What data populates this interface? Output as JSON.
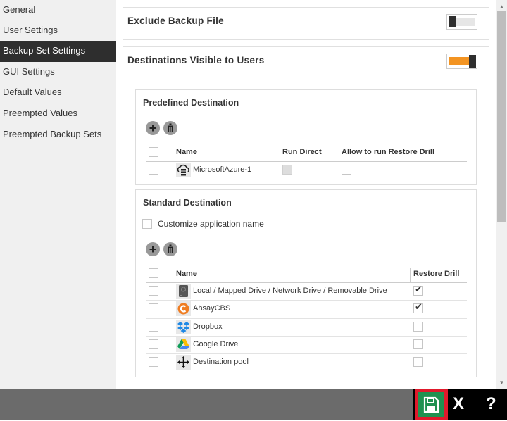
{
  "sidebar": {
    "items": [
      {
        "label": "General",
        "active": false
      },
      {
        "label": "User Settings",
        "active": false
      },
      {
        "label": "Backup Set Settings",
        "active": true
      },
      {
        "label": "GUI Settings",
        "active": false
      },
      {
        "label": "Default Values",
        "active": false
      },
      {
        "label": "Preempted Values",
        "active": false
      },
      {
        "label": "Preempted Backup Sets",
        "active": false
      }
    ]
  },
  "panels": {
    "exclude_backup_file": {
      "title": "Exclude Backup File",
      "toggle": "off"
    },
    "destinations_visible": {
      "title": "Destinations Visible to Users",
      "toggle": "on",
      "accent_color": "#f39422"
    }
  },
  "predefined": {
    "title": "Predefined Destination",
    "add_icon": "plus-icon",
    "delete_icon": "trash-icon",
    "columns": [
      "Name",
      "Run Direct",
      "Allow to run Restore Drill"
    ],
    "rows": [
      {
        "name": "MicrosoftAzure-1",
        "icon": "azure-cloud-icon",
        "selected": false,
        "run_direct": false,
        "run_direct_disabled": true,
        "restore_drill": false
      }
    ]
  },
  "standard": {
    "title": "Standard Destination",
    "customize_label": "Customize application name",
    "customize_checked": false,
    "columns": [
      "Name",
      "Restore Drill"
    ],
    "rows": [
      {
        "name": "Local / Mapped Drive / Network Drive / Removable Drive",
        "icon": "local-drive-icon",
        "restore_drill": true
      },
      {
        "name": "AhsayCBS",
        "icon": "ahsaycbs-icon",
        "restore_drill": true
      },
      {
        "name": "Dropbox",
        "icon": "dropbox-icon",
        "restore_drill": false
      },
      {
        "name": "Google Drive",
        "icon": "google-drive-icon",
        "restore_drill": false
      },
      {
        "name": "Destination pool",
        "icon": "destination-pool-icon",
        "restore_drill": false
      }
    ],
    "check_glyph": "✔"
  },
  "footer": {
    "save_icon": "save-icon",
    "close_label": "X",
    "help_label": "?"
  },
  "glyphs": {
    "plus": "+",
    "up_arrow": "▲",
    "down_arrow": "▼"
  }
}
